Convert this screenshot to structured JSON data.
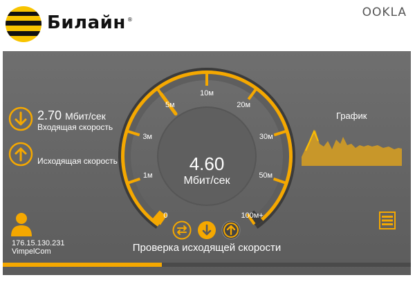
{
  "brand": {
    "name": "Билайн",
    "registered_mark": "®",
    "partner": "OOKLA"
  },
  "download": {
    "value": "2.70",
    "unit": "Мбит/сек",
    "label": "Входящая скорость"
  },
  "upload": {
    "label": "Исходящая скорость"
  },
  "gauge": {
    "current_value": "4.60",
    "unit": "Мбит/сек",
    "ticks": [
      "0",
      "1м",
      "3м",
      "5м",
      "10м",
      "20м",
      "30м",
      "50м",
      "100м+"
    ],
    "needle_tick_position": 3.0
  },
  "graph": {
    "label": "График"
  },
  "client": {
    "ip": "176.15.130.231",
    "isp": "VimpelCom"
  },
  "status": "Проверка исходящей скорости",
  "progress": 0.39,
  "colors": {
    "accent": "#f5a800",
    "panel": "#666666",
    "text": "#ffffff"
  },
  "icons": [
    "download-icon",
    "upload-icon",
    "user-icon",
    "menu-icon",
    "swap-icon"
  ]
}
